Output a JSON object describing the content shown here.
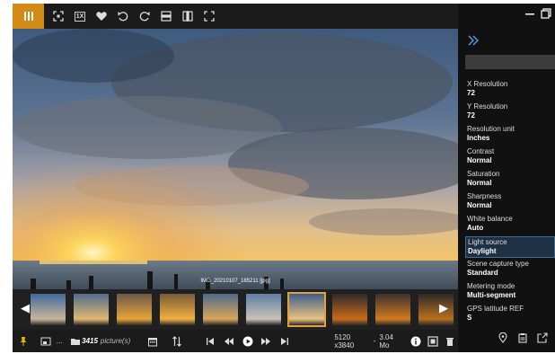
{
  "viewer": {
    "caption": "IMG_20210107_185211 [jpg]",
    "colors": {
      "accent": "#d48a16",
      "selection_border": "#e8a13a",
      "panel_selected": "#1e3144"
    }
  },
  "toolbar": {
    "zoom_label": "1X",
    "icons": [
      "menu-icon",
      "fit-icon",
      "zoom-1x-icon",
      "heart-icon",
      "rotate-left-icon",
      "rotate-right-icon",
      "flip-vertical-icon",
      "flip-horizontal-icon",
      "crop-icon"
    ]
  },
  "thumbnails": {
    "count": 10,
    "selected_index": 6
  },
  "bottombar": {
    "picture_count": "3415",
    "picture_suffix": "picture(s)",
    "ellipsis": "...",
    "dimensions": "5120 x3840",
    "separator": "-",
    "filesize": "3.04 Mo"
  },
  "panel": {
    "properties": [
      {
        "key": "X Resolution",
        "value": "72"
      },
      {
        "key": "Y Resolution",
        "value": "72"
      },
      {
        "key": "Resolution unit",
        "value": "Inches"
      },
      {
        "key": "Contrast",
        "value": "Normal"
      },
      {
        "key": "Saturation",
        "value": "Normal"
      },
      {
        "key": "Sharpness",
        "value": "Normal"
      },
      {
        "key": "White balance",
        "value": "Auto"
      },
      {
        "key": "Light source",
        "value": "Daylight"
      },
      {
        "key": "Scene capture type",
        "value": "Standard"
      },
      {
        "key": "Metering mode",
        "value": "Multi-segment"
      },
      {
        "key": "GPS latitude REF",
        "value": "S"
      }
    ],
    "selected_property_index": 7
  }
}
